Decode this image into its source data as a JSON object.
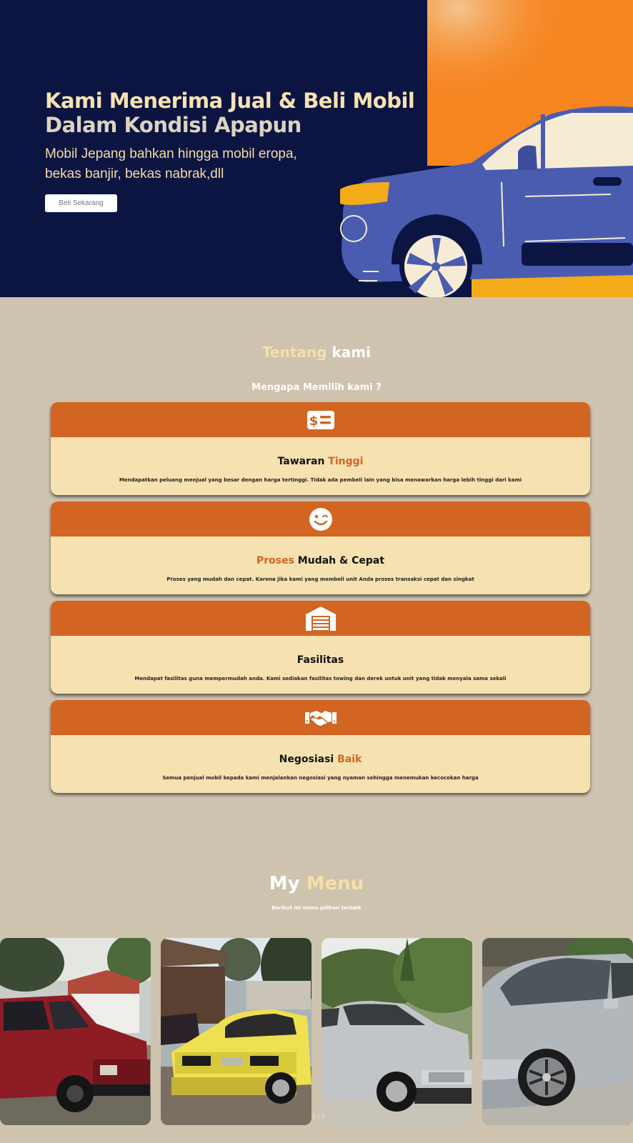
{
  "hero": {
    "title_line1": "Kami Menerima Jual & Beli Mobil",
    "title_line2": "Dalam Kondisi Apapun",
    "subtitle_line1": "Mobil Jepang bahkan hingga mobil eropa,",
    "subtitle_line2": "bekas banjir, bekas nabrak,dll",
    "cta_label": "Beli Sekarang"
  },
  "about": {
    "title_part1": "Tentang",
    "title_part2": "kami",
    "subtitle": "Mengapa Memilih kami ?",
    "cards": [
      {
        "icon": "money-bill-icon",
        "title_a": "Tawaran",
        "title_b": "Tinggi",
        "description": "Mendapatkan peluang menjual yang besar dengan harga tertinggi. Tidak ada pembeli lain yang bisa menawarkan harga lebih tinggi dari kami"
      },
      {
        "icon": "smile-wink-icon",
        "title_a": "Proses",
        "title_b": "Mudah & Cepat",
        "description": "Proses yang mudah dan cepat. Karena jika kami yang membeli unit Anda proses transaksi cepat dan singkat"
      },
      {
        "icon": "warehouse-icon",
        "title_a": "Fasilitas",
        "title_b": "",
        "description": "Mendapat fasilitas guna mempermudah anda. Kami sediakan fasilitas towing dan derek untuk unit yang tidak menyala sama sekali"
      },
      {
        "icon": "handshake-icon",
        "title_a": "Negosiasi",
        "title_b": "Baik",
        "description": "Semua penjual mobil kepada kami menjalankan negosiasi yang nyaman sehingga menemukan kecocokan harga"
      }
    ]
  },
  "menu": {
    "title_part1": "My",
    "title_part2": "Menu",
    "subtitle": "Berikut ini menu pilihan terbaik",
    "pager": "1 / 2",
    "photos": [
      {
        "name": "red-van-photo"
      },
      {
        "name": "yellow-sedan-photo"
      },
      {
        "name": "silver-sedan-photo"
      },
      {
        "name": "silver-coupe-photo"
      }
    ]
  },
  "colors": {
    "hero_bg": "#0c1441",
    "hero_accent": "#f6841f",
    "page_bg": "#cec3ae",
    "card_header": "#d26522",
    "card_body": "#f6e1b0",
    "cream": "#f5dfab"
  }
}
